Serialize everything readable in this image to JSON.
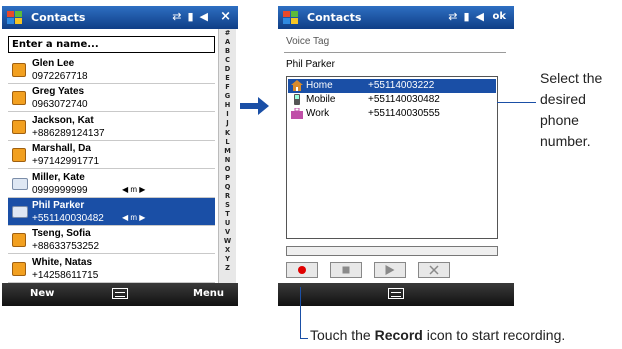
{
  "left_screen": {
    "title": "Contacts",
    "search_placeholder": "Enter a name...",
    "contacts": [
      {
        "name": "Glen Lee",
        "number": "0972267718",
        "nav": "",
        "icon": "contact-icon"
      },
      {
        "name": "Greg Yates",
        "number": "0963072740",
        "nav": "",
        "icon": "contact-icon"
      },
      {
        "name": "Jackson, Kat",
        "number": "+886289124137",
        "nav": "",
        "icon": "contact-icon"
      },
      {
        "name": "Marshall, Da",
        "number": "+97142991771",
        "nav": "",
        "icon": "contact-icon"
      },
      {
        "name": "Miller, Kate",
        "number": "0999999999",
        "nav": "◀ m ▶",
        "icon": "card-icon"
      },
      {
        "name": "Phil Parker",
        "number": "+551140030482",
        "nav": "◀ m ▶",
        "icon": "card-icon"
      },
      {
        "name": "Tseng, Sofia",
        "number": "+88633753252",
        "nav": "",
        "icon": "contact-icon"
      },
      {
        "name": "White, Natas",
        "number": "+14258611715",
        "nav": "",
        "icon": "contact-icon"
      }
    ],
    "selected_index": 5,
    "alphabet": [
      "#",
      "A",
      "B",
      "C",
      "D",
      "E",
      "F",
      "G",
      "H",
      "I",
      "J",
      "K",
      "L",
      "M",
      "N",
      "O",
      "P",
      "Q",
      "R",
      "S",
      "T",
      "U",
      "V",
      "W",
      "X",
      "Y",
      "Z"
    ],
    "softkeys": {
      "left": "New",
      "right": "Menu"
    },
    "close_label": "×"
  },
  "right_screen": {
    "title": "Contacts",
    "ok_label": "ok",
    "section_label": "Voice Tag",
    "contact_name": "Phil Parker",
    "phones": [
      {
        "label": "Home",
        "number": "+55114003222",
        "selected": true
      },
      {
        "label": "Mobile",
        "number": "+551140030482",
        "selected": false
      },
      {
        "label": "Work",
        "number": "+551140030555",
        "selected": false
      }
    ],
    "buttons": [
      "record-button",
      "stop-button",
      "play-button",
      "delete-button"
    ]
  },
  "annotations": {
    "select_phone": "Select the desired phone number.",
    "record_prefix": "Touch the ",
    "record_bold": "Record",
    "record_suffix": " icon to start recording."
  },
  "colors": {
    "titlebar": "#1a4fa6",
    "selection": "#1a4fa6",
    "record": "#e00000"
  }
}
